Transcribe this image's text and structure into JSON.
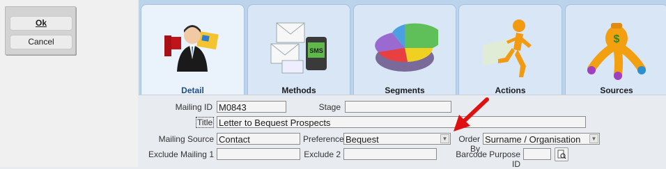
{
  "buttons": {
    "ok": "Ok",
    "cancel": "Cancel"
  },
  "tabs": [
    {
      "label": "Detail",
      "icon": "person-mail-icon",
      "active": true
    },
    {
      "label": "Methods",
      "icon": "envelope-sms-icon",
      "active": false
    },
    {
      "label": "Segments",
      "icon": "pie-chart-icon",
      "active": false
    },
    {
      "label": "Actions",
      "icon": "running-man-icon",
      "active": false
    },
    {
      "label": "Sources",
      "icon": "money-bag-icon",
      "active": false
    }
  ],
  "form": {
    "mailing_id": {
      "label": "Mailing ID",
      "value": "M0843"
    },
    "stage": {
      "label": "Stage",
      "value": ""
    },
    "title": {
      "label": "Title",
      "value": "Letter to Bequest Prospects"
    },
    "mailing_source": {
      "label": "Mailing Source",
      "value": "Contact"
    },
    "preference": {
      "label": "Preference",
      "value": "Bequest"
    },
    "order_by": {
      "label": "Order By",
      "value": "Surname / Organisation"
    },
    "exclude_mailing_1": {
      "label": "Exclude Mailing 1",
      "value": ""
    },
    "exclude_2": {
      "label": "Exclude 2",
      "value": ""
    },
    "barcode_purpose_id": {
      "label": "Barcode Purpose ID",
      "value": ""
    }
  },
  "colors": {
    "accent": "#1e4e8c",
    "arrow": "#e01010",
    "tab_bg": "#d8e6f5"
  }
}
